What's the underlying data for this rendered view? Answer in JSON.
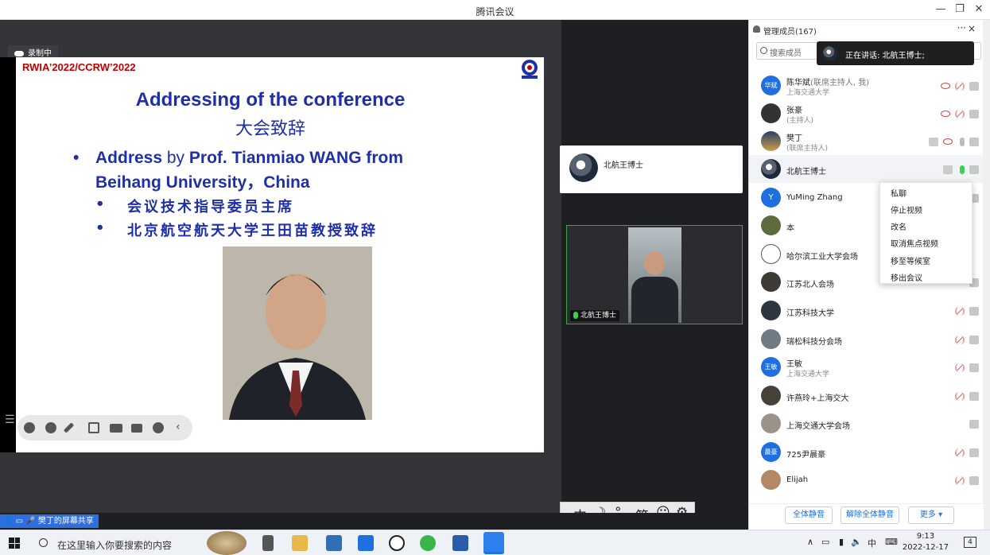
{
  "window": {
    "title": "腾讯会议"
  },
  "recording": {
    "label": "录制中"
  },
  "slide": {
    "header": "RWIA’2022/CCRW’2022",
    "title_en": "Addressing of the conference",
    "title_cn": "大会致辞",
    "bullet1_bold": "Address",
    "bullet1_mid": " by ",
    "bullet1_rest": "Prof. Tianmiao WANG from",
    "bullet1_line2": "Beihang University，China",
    "bullet2": "会议技术指导委员主席",
    "bullet3": "北京航空航天大学王田苗教授致辞"
  },
  "speaker_card": {
    "name": "北航王博士"
  },
  "video_tile": {
    "name": "北航王博士"
  },
  "ime": {
    "mode": "中",
    "moon": "☽",
    "punct": "°,",
    "simp": "简",
    "emoji": "☺",
    "gear": "⚙"
  },
  "share_status": {
    "label": "樊丁的屏幕共享"
  },
  "members": {
    "title": "管理成员(167)",
    "more": "···",
    "close": "×",
    "search_placeholder": "搜索成员",
    "speaking": "正在讲话: 北航王博士;",
    "list": [
      {
        "name": "陈华斌",
        "role": "(联席主持人, 我)",
        "org": "上海交通大学",
        "avatar": "华斌"
      },
      {
        "name": "张豪",
        "role": "",
        "org": "(主持人)",
        "avatar": ""
      },
      {
        "name": "樊丁",
        "role": "",
        "org": "(联席主持人)",
        "avatar": ""
      },
      {
        "name": "北航王博士",
        "role": "",
        "org": "",
        "avatar": ""
      },
      {
        "name": "YuMing Zhang",
        "role": "",
        "org": "",
        "avatar": "Y"
      },
      {
        "name": "本",
        "role": "",
        "org": "",
        "avatar": ""
      },
      {
        "name": "哈尔滨工业大学会场",
        "role": "",
        "org": "",
        "avatar": ""
      },
      {
        "name": "江苏北人会场",
        "role": "",
        "org": "",
        "avatar": ""
      },
      {
        "name": "江苏科技大学",
        "role": "",
        "org": "",
        "avatar": ""
      },
      {
        "name": "瑞松科技分会场",
        "role": "",
        "org": "",
        "avatar": ""
      },
      {
        "name": "王敏",
        "role": "",
        "org": "上海交通大学",
        "avatar": "王敏"
      },
      {
        "name": "许燕玲+上海交大",
        "role": "",
        "org": "",
        "avatar": ""
      },
      {
        "name": "上海交通大学会场",
        "role": "",
        "org": "",
        "avatar": ""
      },
      {
        "name": "725尹晨豪",
        "role": "",
        "org": "",
        "avatar": "晨豪"
      },
      {
        "name": "Elijah",
        "role": "",
        "org": "",
        "avatar": ""
      }
    ],
    "context_menu": [
      "私聊",
      "停止视频",
      "改名",
      "取消焦点视频",
      "移至等候室",
      "移出会议"
    ],
    "footer": {
      "mute_all": "全体静音",
      "unmute_all": "解除全体静音",
      "more": "更多 ▾"
    }
  },
  "taskbar": {
    "search_placeholder": "在这里输入你要搜索的内容",
    "ime": "中",
    "time": "9:13",
    "date": "2022-12-17",
    "notification_count": "4"
  },
  "colors": {
    "accent": "#1e6fe0",
    "slide_text": "#1f2fa8",
    "slide_header": "#c00000"
  }
}
